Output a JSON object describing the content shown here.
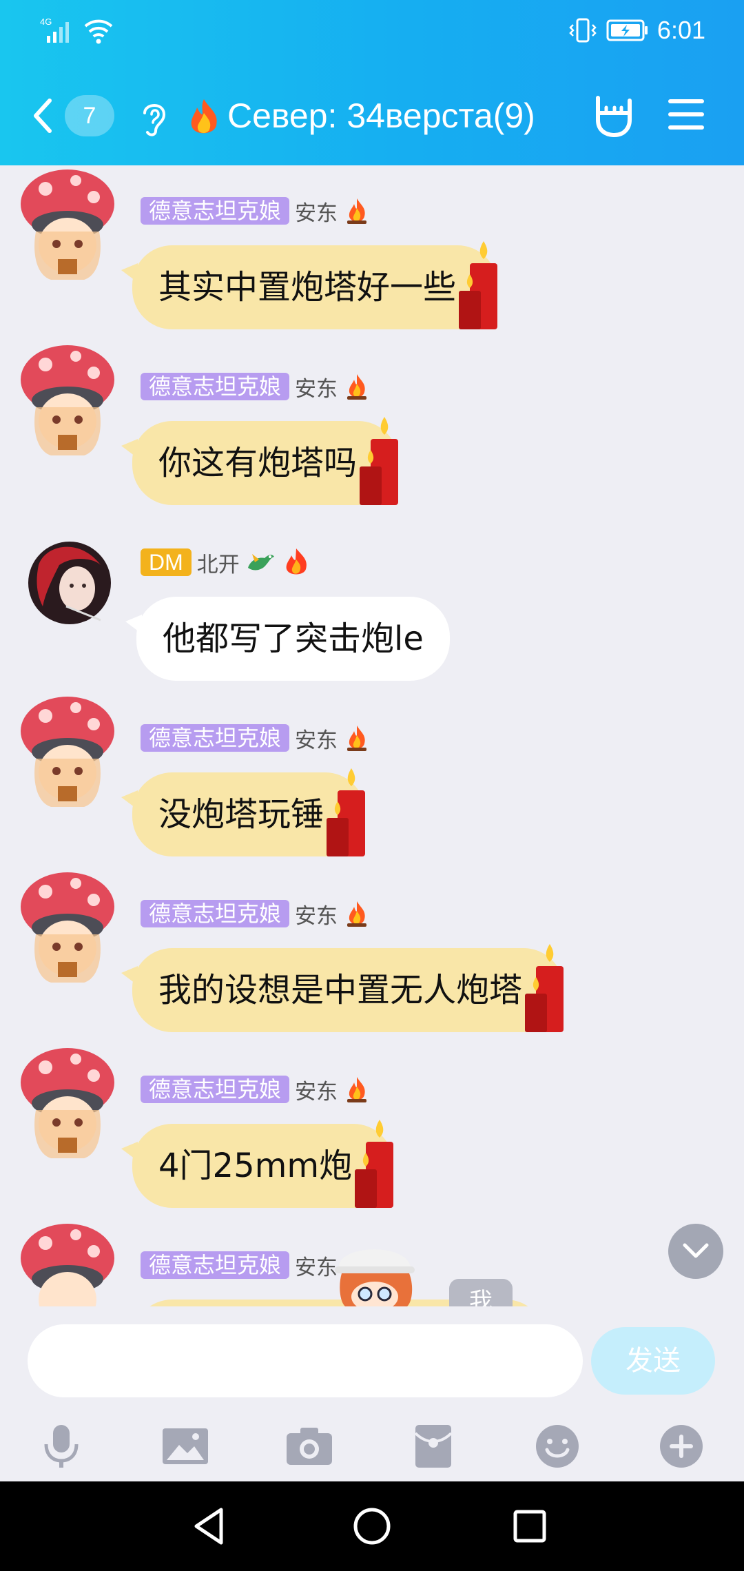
{
  "status": {
    "network": "4G",
    "time": "6:01"
  },
  "header": {
    "back_count": "7",
    "title": "Север: 34верста(9)"
  },
  "messages": [
    {
      "tag": "德意志坦克娘",
      "sender": "安东",
      "text": "其实中置炮塔好一些",
      "style": "yellow"
    },
    {
      "tag": "德意志坦克娘",
      "sender": "安东",
      "text": "你这有炮塔吗",
      "style": "yellow"
    },
    {
      "tag": "DM",
      "sender": "北开",
      "text": "他都写了突击炮le",
      "style": "white"
    },
    {
      "tag": "德意志坦克娘",
      "sender": "安东",
      "text": "没炮塔玩锤",
      "style": "yellow"
    },
    {
      "tag": "德意志坦克娘",
      "sender": "安东",
      "text": "我的设想是中置无人炮塔",
      "style": "yellow"
    },
    {
      "tag": "德意志坦克娘",
      "sender": "安东",
      "text": "4门25mm炮",
      "style": "yellow"
    },
    {
      "tag": "德意志坦克娘",
      "sender": "安东",
      "text": "",
      "style": "yellow"
    }
  ],
  "peek": {
    "label": "我"
  },
  "composer": {
    "placeholder": "",
    "send_label": "发送"
  },
  "colors": {
    "accent": "#16aef1",
    "bubble_yellow": "#f9e6a8",
    "tag_purple": "#b79cf0",
    "tag_dm": "#f3b21c"
  }
}
